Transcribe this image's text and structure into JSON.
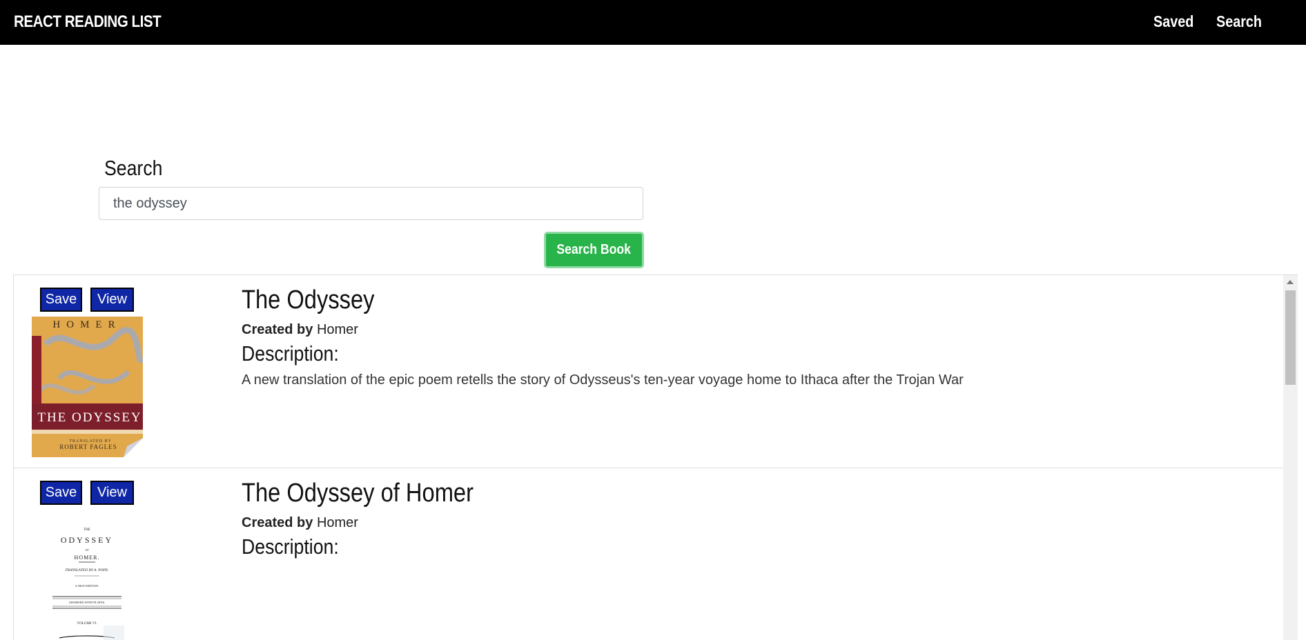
{
  "navbar": {
    "brand": "REACT READING LIST",
    "links": [
      "Saved",
      "Search"
    ]
  },
  "search": {
    "label": "Search",
    "value": "the odyssey",
    "button": "Search Book"
  },
  "results": [
    {
      "title": "The Odyssey",
      "created_by_label": "Created by",
      "author": "Homer",
      "description_label": "Description:",
      "description": "A new translation of the epic poem retells the story of Odysseus's ten-year voyage home to Ithaca after the Trojan War",
      "save_label": "Save",
      "view_label": "View",
      "cover": {
        "top_text": "HOMER",
        "title_text": "THE ODYSSEY",
        "translator_line1": "TRANSLATED BY",
        "translator_line2": "ROBERT FAGLES"
      }
    },
    {
      "title": "The Odyssey of Homer",
      "created_by_label": "Created by",
      "author": "Homer",
      "description_label": "Description:",
      "description": "",
      "save_label": "Save",
      "view_label": "View",
      "cover": {
        "line1": "THE",
        "line2": "ODYSSEY",
        "line3": "OF",
        "line4": "HOMER.",
        "line5": "TRANSLATED BY A. POPE.",
        "line6": "A NEW EDITION.",
        "line7": "ADORNED WITH PLATES.",
        "line8": "VOLUME VI."
      }
    }
  ],
  "colors": {
    "navbar_bg": "#000000",
    "search_button": "#28b44a",
    "action_button": "#0f27a6"
  }
}
